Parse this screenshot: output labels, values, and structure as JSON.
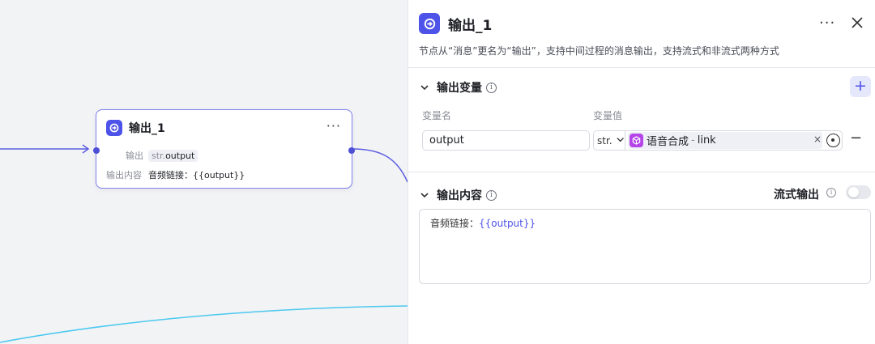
{
  "canvas": {
    "node": {
      "title": "输出_1",
      "more": "···",
      "output_label": "输出",
      "output_type": "str.",
      "output_var": "output",
      "content_label": "输出内容",
      "content_value": "音频链接：{{output}}"
    }
  },
  "panel": {
    "title": "输出_1",
    "more": "···",
    "description": "节点从“消息”更名为“输出”，支持中间过程的消息输出，支持流式和非流式两种方式",
    "variables_section": {
      "title": "输出变量",
      "info": "i",
      "add": "+",
      "col_name": "变量名",
      "col_value": "变量值",
      "rows": [
        {
          "name": "output",
          "type": "str.",
          "ref_node": "语音合成",
          "ref_sep": "-",
          "ref_var": "link",
          "clear": "×",
          "remove": "−"
        }
      ]
    },
    "content_section": {
      "title": "输出内容",
      "info": "i",
      "stream_label": "流式输出",
      "stream_info": "i",
      "stream_enabled": false,
      "content_prefix": "音频链接：",
      "content_var": "{{output}}"
    }
  },
  "colors": {
    "accent": "#4d53e8",
    "node_border": "#7d7fea",
    "edge_purple": "#5b5ee0",
    "edge_cyan": "#4cc9f0",
    "ref_icon": "#b545e8"
  }
}
